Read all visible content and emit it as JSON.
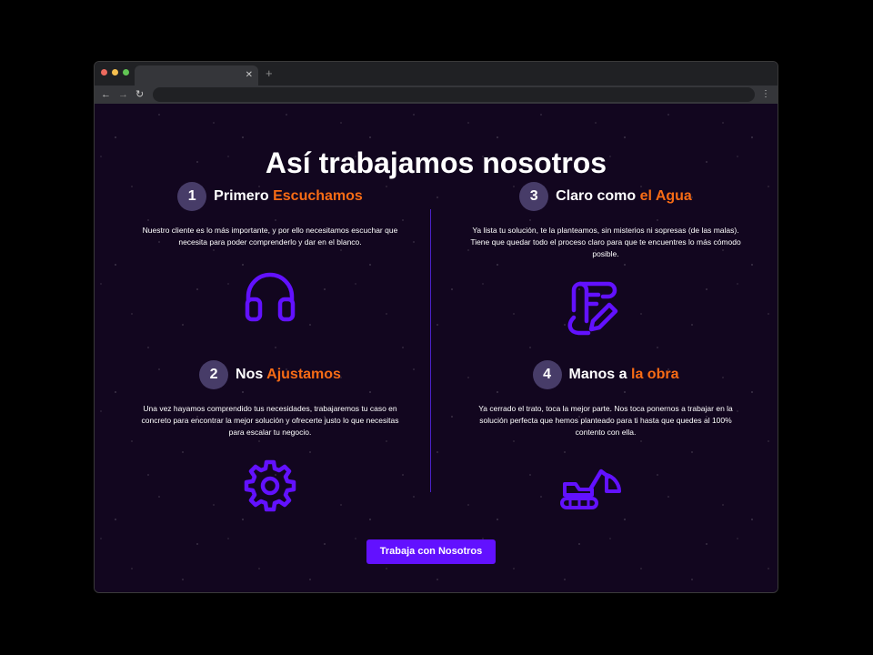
{
  "page": {
    "title": "Así trabajamos nosotros",
    "cta_label": "Trabaja con Nosotros"
  },
  "steps": [
    {
      "number": "1",
      "title_plain": "Primero",
      "title_accent": "Escuchamos",
      "description": "Nuestro cliente es lo más importante, y por ello necesitamos escuchar que necesita para poder comprenderlo y dar en el blanco.",
      "icon": "headphones-icon"
    },
    {
      "number": "2",
      "title_plain": "Nos",
      "title_accent": "Ajustamos",
      "description": "Una vez hayamos comprendido tus necesidades, trabajaremos tu caso en concreto para encontrar la mejor solución y ofrecerte justo lo que necesitas para escalar tu negocio.",
      "icon": "gear-icon"
    },
    {
      "number": "3",
      "title_plain": "Claro como",
      "title_accent": "el Agua",
      "description": "Ya lista tu solución, te la planteamos, sin misterios ni sopresas (de las malas). Tiene que quedar todo el proceso claro para que te encuentres lo más cómodo posible.",
      "icon": "document-edit-icon"
    },
    {
      "number": "4",
      "title_plain": "Manos a",
      "title_accent": "la obra",
      "description": "Ya cerrado el trato, toca la mejor parte. Nos toca ponernos a trabajar en la solución perfecta que hemos planteado para ti hasta que quedes al 100% contento con ella.",
      "icon": "excavator-icon"
    }
  ],
  "colors": {
    "background": "#12061f",
    "accent": "#f76b15",
    "icon": "#6211ff",
    "button": "#6211ff",
    "number_badge": "#473c68",
    "divider": "#4a22c7"
  }
}
